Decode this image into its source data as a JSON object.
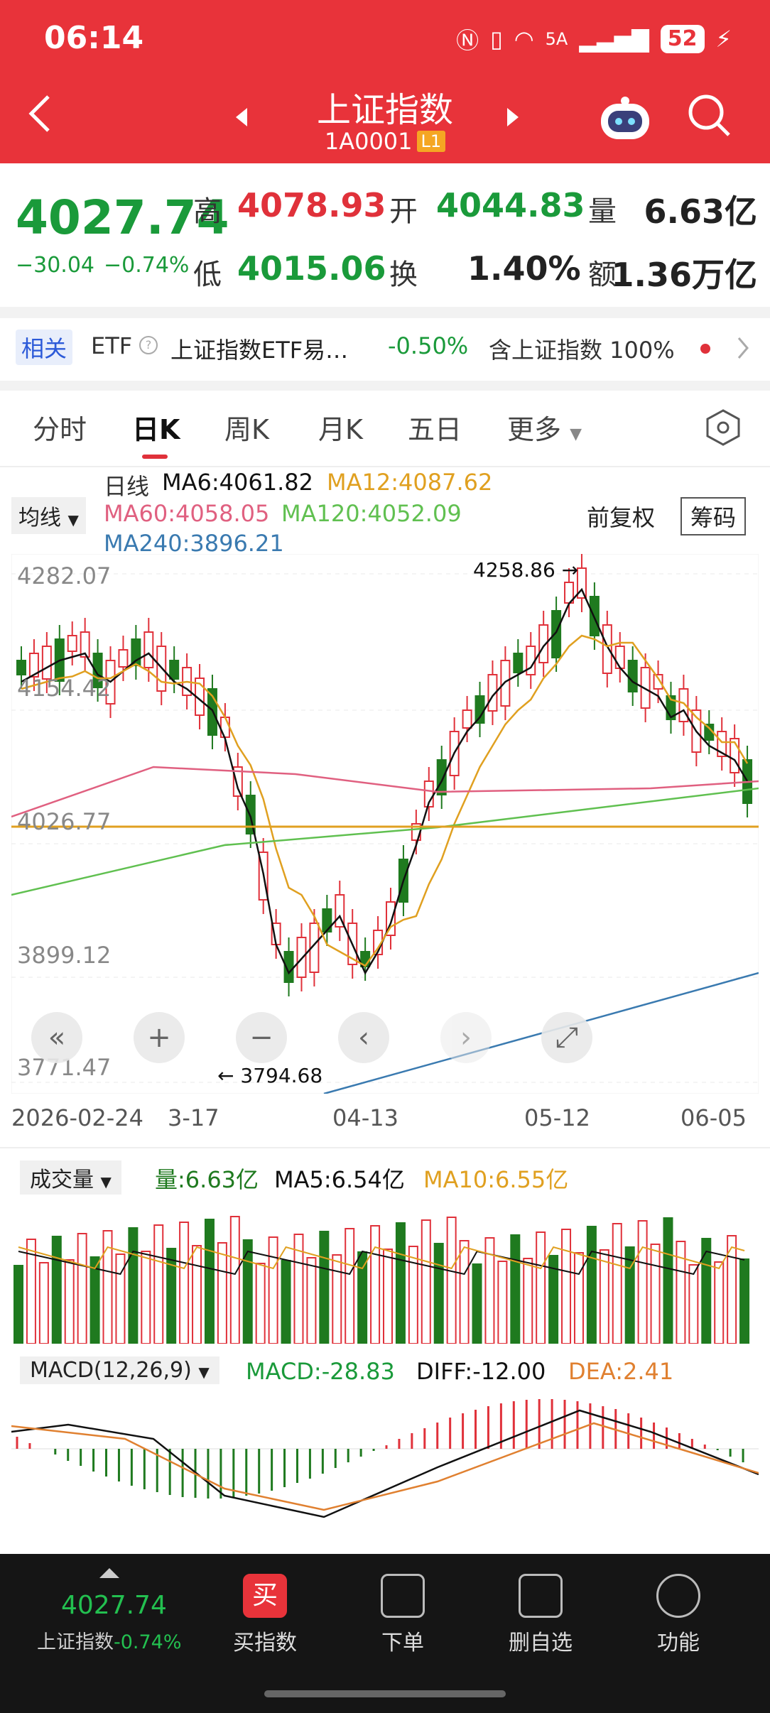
{
  "status_bar": {
    "time": "06:14",
    "network": "5A",
    "battery": "52"
  },
  "header": {
    "title": "上证指数",
    "code": "1A0001",
    "level_badge": "L1"
  },
  "quote": {
    "price": "4027.74",
    "change": "−30.04",
    "change_pct": "−0.74%",
    "high_label": "高",
    "high": "4078.93",
    "open_label": "开",
    "open": "4044.83",
    "volume_label": "量",
    "volume": "6.63亿",
    "low_label": "低",
    "low": "4015.06",
    "turnover_label": "换",
    "turnover": "1.40%",
    "amount_label": "额",
    "amount": "1.36万亿"
  },
  "etf_row": {
    "tag": "相关",
    "etf": "ETF",
    "name": "上证指数ETF易…",
    "pct": "-0.50%",
    "contain": "含上证指数 100%"
  },
  "tabs": [
    "分时",
    "日K",
    "周K",
    "月K",
    "五日",
    "更多"
  ],
  "active_tab": "日K",
  "kline": {
    "ma_select": "均线",
    "line_label": "日线",
    "ma6": "MA6:4061.82",
    "ma12": "MA12:4087.62",
    "ma60": "MA60:4058.05",
    "ma120": "MA120:4052.09",
    "ma240": "MA240:3896.21",
    "adjust": "前复权",
    "chip_button": "筹码",
    "y_ticks": [
      "4282.07",
      "4154.42",
      "4026.77",
      "3899.12",
      "3771.47"
    ],
    "max_label": "4258.86",
    "min_label": "3794.68",
    "x_ticks": [
      "2026-02-24",
      "3-17",
      "04-13",
      "05-12",
      "06-05"
    ]
  },
  "volume": {
    "select": "成交量",
    "vol": "量:6.63亿",
    "ma5": "MA5:6.54亿",
    "ma10": "MA10:6.55亿"
  },
  "macd": {
    "select": "MACD(12,26,9)",
    "macd": "MACD:-28.83",
    "diff": "DIFF:-12.00",
    "dea": "DEA:2.41"
  },
  "bottom": {
    "price": "4027.74",
    "name": "上证指数",
    "pct": "-0.74%",
    "items": [
      "买指数",
      "下单",
      "删自选",
      "功能"
    ],
    "buy_badge": "买"
  },
  "colors": {
    "red": "#e8333a",
    "up": "#e0313a",
    "down": "#1f7a1f",
    "ma6": "#111111",
    "ma12": "#e0a020",
    "ma60": "#e06080",
    "ma120": "#60c050",
    "ma240": "#3a7ab0"
  }
}
